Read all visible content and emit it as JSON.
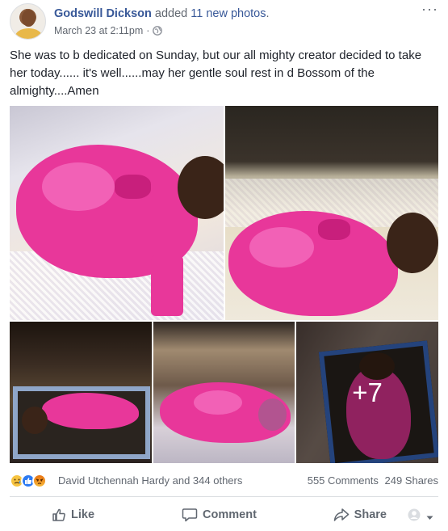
{
  "post": {
    "author": "Godswill Dickson",
    "action_text": "added",
    "photos_link": "11 new photos",
    "timestamp": "March 23 at 2:11pm",
    "separator": "·",
    "more_options": "···",
    "text": "She was to b dedicated on Sunday, but our all mighty creator decided to take her today...... it's well......may her gentle soul rest in d Bossom of the almighty....Amen"
  },
  "gallery": {
    "more_count": "+7"
  },
  "icons": {
    "privacy": "globe-icon",
    "like": "thumbs-up-icon",
    "comment": "speech-bubble-icon",
    "share": "share-arrow-icon",
    "audience": "avatar-dropdown-icon"
  },
  "stats": {
    "reactions": [
      "sad",
      "like",
      "angry"
    ],
    "reaction_names": "David Utchennah Hardy and 344 others",
    "comments": "555 Comments",
    "shares": "249 Shares"
  },
  "actions": {
    "like": "Like",
    "comment": "Comment",
    "share": "Share"
  },
  "colors": {
    "link_blue": "#385898",
    "meta_gray": "#616770",
    "dress_pink": "#e8379a"
  }
}
